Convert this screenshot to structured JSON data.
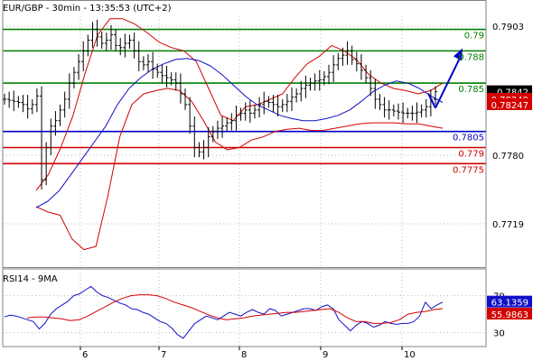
{
  "header": {
    "symbol_info": "EUR/GBP - 30min - 13:35:53 (UTC+2)"
  },
  "colors": {
    "background": "#ffffff",
    "frame": "#808080",
    "grid": "#b8b8b8",
    "price_bars": "#000000",
    "bollinger": "#d40000",
    "moving_average": "#1010c8",
    "resistance": "#008000",
    "support_pivot": "#0000c8",
    "support": "#d00000",
    "projection_arrow": "#0000c8",
    "current_price_tag": "#000000",
    "indicator_tag": "#d40000",
    "rsi_line": "#1010c8",
    "rsi_ma": "#d40000"
  },
  "chart_data": [
    {
      "type": "line",
      "title": "EUR/GBP - 30min - 13:35:53 (UTC+2)",
      "x_tick_labels": [
        "6",
        "7",
        "8",
        "9",
        "10"
      ],
      "y_tick_labels": [
        "0.7903",
        "0.7780",
        "0.7719"
      ],
      "ylim": [
        0.7665,
        0.7935
      ],
      "grid": true,
      "series": [
        {
          "name": "price",
          "style": "ohlc-bars",
          "values": [
            0.7835,
            0.7834,
            0.7833,
            0.7832,
            0.783,
            0.7826,
            0.783,
            0.7838,
            0.776,
            0.779,
            0.781,
            0.7815,
            0.7825,
            0.7835,
            0.785,
            0.786,
            0.787,
            0.788,
            0.789,
            0.79,
            0.7893,
            0.7887,
            0.789,
            0.7895,
            0.7885,
            0.7883,
            0.7887,
            0.789,
            0.788,
            0.787,
            0.7867,
            0.787,
            0.7863,
            0.786,
            0.7857,
            0.7855,
            0.7853,
            0.785,
            0.784,
            0.783,
            0.781,
            0.779,
            0.7786,
            0.779,
            0.78,
            0.7805,
            0.7808,
            0.781,
            0.7813,
            0.7815,
            0.782,
            0.7822,
            0.7825,
            0.7822,
            0.7825,
            0.783,
            0.7833,
            0.7832,
            0.783,
            0.7828,
            0.783,
            0.7833,
            0.7837,
            0.784,
            0.7845,
            0.7848,
            0.785,
            0.7852,
            0.7853,
            0.7856,
            0.786,
            0.7867,
            0.7873,
            0.7876,
            0.788,
            0.7872,
            0.7868,
            0.7862,
            0.7855,
            0.7845,
            0.7835,
            0.783,
            0.7825,
            0.7825,
            0.7824,
            0.7823,
            0.7822,
            0.7822,
            0.7822,
            0.7823,
            0.7825,
            0.7828,
            0.7835,
            0.7842
          ]
        },
        {
          "name": "moving average",
          "style": "line",
          "values": [
            0.7734,
            0.774,
            0.775,
            0.7765,
            0.778,
            0.7795,
            0.781,
            0.783,
            0.7845,
            0.7855,
            0.7863,
            0.7868,
            0.7872,
            0.7873,
            0.7871,
            0.7866,
            0.7858,
            0.7848,
            0.7838,
            0.783,
            0.7825,
            0.782,
            0.7817,
            0.7815,
            0.7815,
            0.7817,
            0.782,
            0.7825,
            0.7833,
            0.7842,
            0.7848,
            0.7852,
            0.785,
            0.7845,
            0.7838,
            0.7832
          ]
        },
        {
          "name": "bollinger upper",
          "style": "line",
          "values": [
            0.775,
            0.7765,
            0.779,
            0.782,
            0.786,
            0.7895,
            0.791,
            0.791,
            0.7905,
            0.7897,
            0.7888,
            0.7883,
            0.788,
            0.787,
            0.7845,
            0.782,
            0.7815,
            0.7828,
            0.783,
            0.7835,
            0.784,
            0.7855,
            0.7868,
            0.7875,
            0.7885,
            0.788,
            0.7872,
            0.7858,
            0.785,
            0.7845,
            0.7843,
            0.784,
            0.7843,
            0.785
          ]
        },
        {
          "name": "bollinger lower",
          "style": "line",
          "values": [
            0.7735,
            0.773,
            0.7727,
            0.7705,
            0.7695,
            0.7698,
            0.7745,
            0.78,
            0.783,
            0.784,
            0.7843,
            0.7845,
            0.7843,
            0.7833,
            0.7815,
            0.7795,
            0.7788,
            0.779,
            0.7797,
            0.78,
            0.7805,
            0.7807,
            0.7808,
            0.7806,
            0.7806,
            0.7808,
            0.781,
            0.7812,
            0.7813,
            0.7813,
            0.7813,
            0.7812,
            0.7812,
            0.781,
            0.7808
          ]
        }
      ],
      "levels": [
        {
          "label": "0.79",
          "value": 0.79,
          "kind": "resistance"
        },
        {
          "label": "0.788",
          "value": 0.788,
          "kind": "resistance"
        },
        {
          "label": "0.785",
          "value": 0.785,
          "kind": "resistance"
        },
        {
          "label": "0.7805",
          "value": 0.7805,
          "kind": "pivot"
        },
        {
          "label": "0.779",
          "value": 0.779,
          "kind": "support"
        },
        {
          "label": "0.7775",
          "value": 0.7775,
          "kind": "support"
        }
      ],
      "price_tags": [
        {
          "label": "0.7842",
          "value": 0.7842,
          "kind": "current"
        },
        {
          "label": "0.78249",
          "value": 0.78249,
          "kind": "indicator"
        },
        {
          "label": "0.78247",
          "value": 0.78247,
          "kind": "indicator"
        }
      ],
      "projection": {
        "from": 0.7842,
        "to": 0.788
      }
    },
    {
      "type": "line",
      "title": "RSI14 - 9MA",
      "y_tick_labels": [
        "70",
        "30"
      ],
      "ylim": [
        15,
        95
      ],
      "grid": true,
      "series": [
        {
          "name": "RSI14",
          "values": [
            47,
            49,
            48,
            46,
            44,
            42,
            34,
            40,
            50,
            56,
            60,
            64,
            70,
            72,
            76,
            80,
            74,
            70,
            68,
            65,
            62,
            60,
            56,
            55,
            52,
            50,
            46,
            42,
            40,
            35,
            28,
            24,
            32,
            40,
            44,
            48,
            46,
            44,
            48,
            52,
            50,
            48,
            52,
            55,
            52,
            50,
            56,
            54,
            48,
            50,
            52,
            54,
            56,
            56,
            54,
            58,
            60,
            56,
            44,
            38,
            32,
            38,
            42,
            40,
            36,
            38,
            42,
            40,
            39,
            40,
            40,
            42,
            48,
            63,
            56,
            60,
            63
          ]
        },
        {
          "name": "9MA",
          "values": [
            46,
            47,
            47,
            46,
            45,
            43,
            44,
            48,
            53,
            58,
            63,
            67,
            70,
            71,
            71,
            70,
            67,
            63,
            60,
            57,
            53,
            49,
            46,
            44,
            45,
            46,
            48,
            49,
            50,
            51,
            52,
            52,
            53,
            54,
            55,
            56,
            52,
            46,
            42,
            42,
            40,
            40,
            41,
            44,
            50,
            52,
            53,
            55,
            56
          ]
        }
      ],
      "value_tags": [
        {
          "label": "63.1359",
          "value": 63.1359,
          "kind": "rsi"
        },
        {
          "label": "55.9863",
          "value": 55.9863,
          "kind": "ma"
        }
      ]
    }
  ]
}
